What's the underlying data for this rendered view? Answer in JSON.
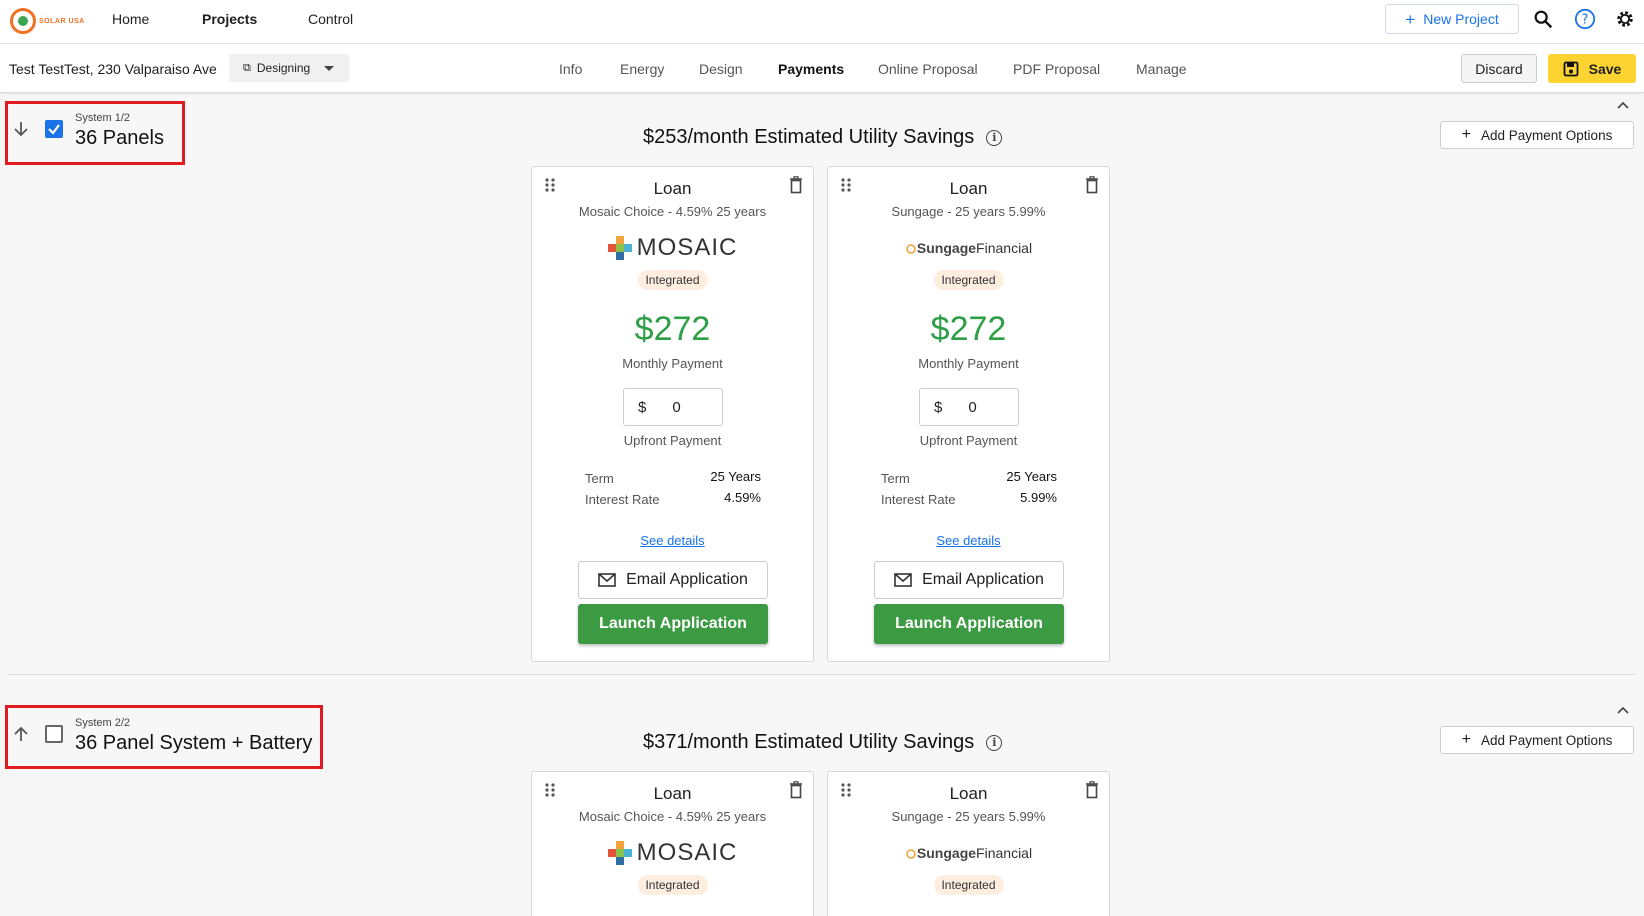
{
  "brand": {
    "logo_text": "SOLAR USA"
  },
  "topnav": {
    "links": [
      "Home",
      "Projects",
      "Control"
    ],
    "new_project": "New Project"
  },
  "subnav": {
    "address": "Test TestTest, 230 Valparaiso Ave",
    "stage": "Designing",
    "tabs": [
      "Info",
      "Energy",
      "Design",
      "Payments",
      "Online Proposal",
      "PDF Proposal",
      "Manage"
    ],
    "active_tab": "Payments",
    "discard": "Discard",
    "save": "Save"
  },
  "systems": [
    {
      "label": "System 1/2",
      "title": "36 Panels",
      "checked": true,
      "savings": "$253/month Estimated Utility Savings",
      "add_payment": "Add Payment Options",
      "cards": [
        {
          "type": "Loan",
          "subtitle": "Mosaic Choice - 4.59% 25 years",
          "lender": "MOSAIC",
          "badge": "Integrated",
          "amount": "$272",
          "amount_label": "Monthly Payment",
          "currency": "$",
          "upfront_value": "0",
          "upfront_label": "Upfront Payment",
          "term_label": "Term",
          "term_value": "25 Years",
          "rate_label": "Interest Rate",
          "rate_value": "4.59%",
          "details": "See details",
          "email": "Email Application",
          "launch": "Launch Application"
        },
        {
          "type": "Loan",
          "subtitle": "Sungage - 25 years 5.99%",
          "lender_a": "Sungage",
          "lender_b": "Financial",
          "badge": "Integrated",
          "amount": "$272",
          "amount_label": "Monthly Payment",
          "currency": "$",
          "upfront_value": "0",
          "upfront_label": "Upfront Payment",
          "term_label": "Term",
          "term_value": "25 Years",
          "rate_label": "Interest Rate",
          "rate_value": "5.99%",
          "details": "See details",
          "email": "Email Application",
          "launch": "Launch Application"
        }
      ]
    },
    {
      "label": "System 2/2",
      "title": "36 Panel System + Battery",
      "checked": false,
      "savings": "$371/month Estimated Utility Savings",
      "add_payment": "Add Payment Options",
      "cards": [
        {
          "type": "Loan",
          "subtitle": "Mosaic Choice - 4.59% 25 years",
          "lender": "MOSAIC",
          "badge": "Integrated"
        },
        {
          "type": "Loan",
          "subtitle": "Sungage - 25 years 5.99%",
          "lender_a": "Sungage",
          "lender_b": "Financial",
          "badge": "Integrated"
        }
      ]
    }
  ],
  "colors": {
    "accent": "#1a73e8",
    "save": "#fcd331",
    "launch": "#3c9a43",
    "amount": "#2e9e47",
    "highlight": "#e11b22"
  }
}
